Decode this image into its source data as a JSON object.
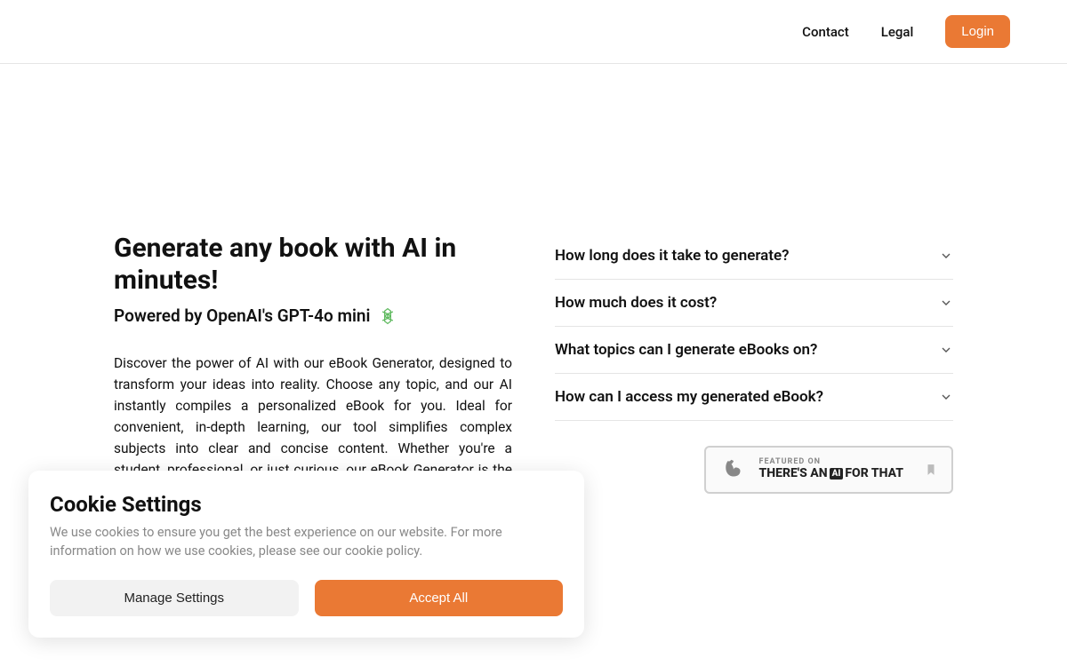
{
  "nav": {
    "contact": "Contact",
    "legal": "Legal",
    "login": "Login"
  },
  "hero": {
    "title": "Generate any book with AI in minutes!",
    "subtitle": "Powered by OpenAI's GPT-4o mini",
    "description": "Discover the power of AI with our eBook Generator, designed to transform your ideas into reality. Choose any topic, and our AI instantly compiles a personalized eBook for you. Ideal for convenient, in-depth learning, our tool simplifies complex subjects into clear and concise content. Whether you're a student, professional, or just curious, our eBook Generator is the perfect tool for you."
  },
  "faq": [
    {
      "question": "How long does it take to generate?"
    },
    {
      "question": "How much does it cost?"
    },
    {
      "question": "What topics can I generate eBooks on?"
    },
    {
      "question": "How can I access my generated eBook?"
    }
  ],
  "featured": {
    "top": "FEATURED ON",
    "before": "THERE'S AN",
    "ai": "AI",
    "after": "FOR THAT"
  },
  "cookie": {
    "title": "Cookie Settings",
    "description": "We use cookies to ensure you get the best experience on our website. For more information on how we use cookies, please see our cookie policy.",
    "manage": "Manage Settings",
    "accept": "Accept All"
  },
  "colors": {
    "accent": "#ea7934"
  }
}
